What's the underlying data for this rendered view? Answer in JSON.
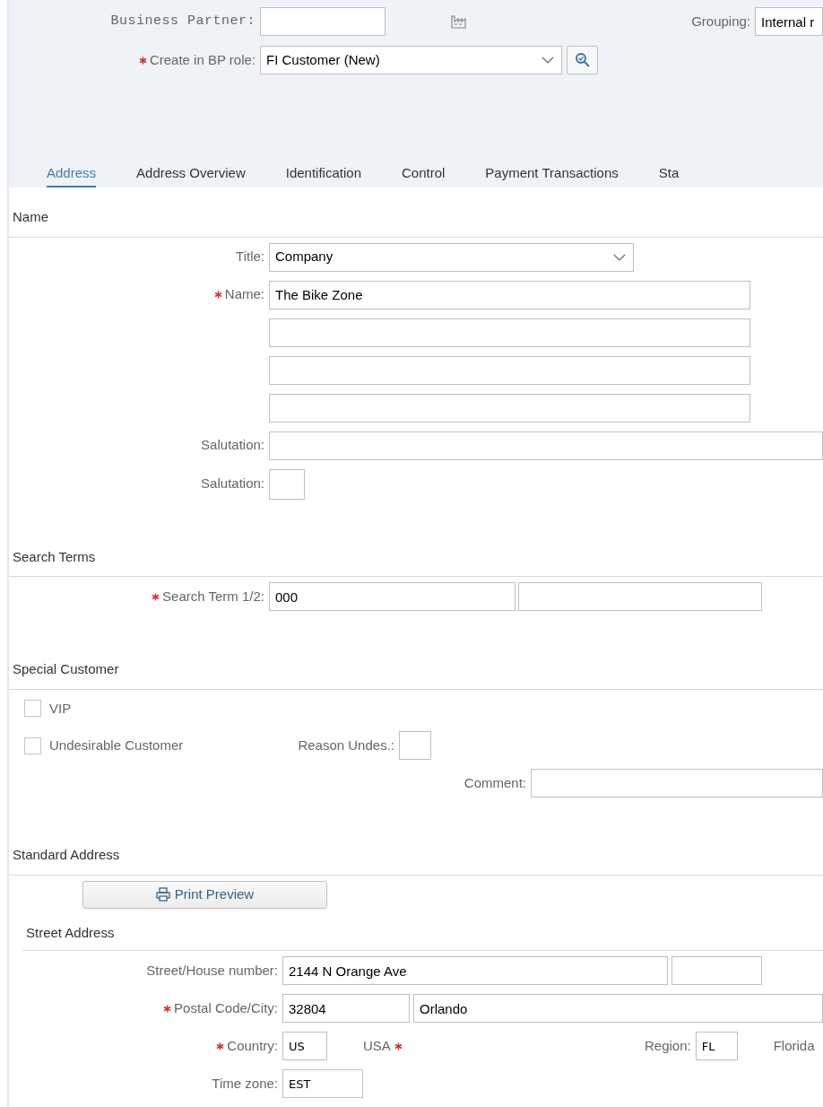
{
  "header": {
    "business_partner": {
      "label": "Business Partner:",
      "required": false
    },
    "grouping": {
      "label": "Grouping:",
      "value": "Internal r"
    },
    "bp_role": {
      "label": "Create in BP role:",
      "required": true,
      "value": "FI Customer (New)"
    }
  },
  "tabs": [
    {
      "label": "Address",
      "selected": true
    },
    {
      "label": "Address Overview",
      "selected": false
    },
    {
      "label": "Identification",
      "selected": false
    },
    {
      "label": "Control",
      "selected": false
    },
    {
      "label": "Payment Transactions",
      "selected": false
    },
    {
      "label": "Sta",
      "selected": false
    }
  ],
  "name_section": {
    "title": "Name",
    "rows": [
      {
        "label": "Title:",
        "required": false,
        "inputs": [
          {
            "kind": "select",
            "value": "Company"
          }
        ]
      },
      {
        "label": "Name:",
        "required": true,
        "inputs": [
          {
            "kind": "text",
            "value": "The Bike Zone"
          }
        ]
      },
      {
        "inputs": [
          {
            "kind": "text"
          }
        ]
      },
      {
        "inputs": [
          {
            "kind": "text"
          }
        ]
      },
      {
        "inputs": [
          {
            "kind": "text"
          }
        ]
      },
      {
        "label": "Salutation:",
        "required": false,
        "inputs": [
          {
            "kind": "text"
          }
        ]
      },
      {
        "label": "Salutation:",
        "required": false,
        "inputs": [
          {
            "kind": "text"
          }
        ]
      }
    ]
  },
  "search_terms": {
    "title": "Search Terms",
    "rows": [
      {
        "label": "Search Term 1/2:",
        "required": true,
        "inputs": [
          {
            "kind": "text",
            "value": "000"
          },
          {
            "kind": "text"
          }
        ]
      }
    ]
  },
  "special_customer": {
    "title": "Special Customer",
    "checkboxes": [
      {
        "label": "VIP",
        "checked": false
      },
      {
        "label": "Undesirable Customer",
        "checked": false
      }
    ],
    "reason": {
      "label": "Reason Undes.:"
    },
    "comment": {
      "label": "Comment:"
    }
  },
  "standard_address": {
    "title": "Standard Address",
    "print_preview": {
      "label": "Print Preview"
    },
    "street_address": {
      "title": "Street Address",
      "rows": [
        {
          "label": "Street/House number:",
          "required": false,
          "inputs": [
            {
              "kind": "text",
              "value": "2144 N Orange Ave"
            },
            {
              "kind": "text"
            }
          ]
        },
        {
          "label": "Postal Code/City:",
          "required": true,
          "inputs": [
            {
              "kind": "text",
              "value": "32804"
            },
            {
              "kind": "text",
              "value": "Orlando"
            }
          ]
        },
        {
          "label": "Country:",
          "required": true,
          "inputs": [
            {
              "kind": "code",
              "value": "US"
            }
          ],
          "description": {
            "text": "USA",
            "required": true
          },
          "extra": {
            "label": "Region:",
            "value": "FL",
            "description": "Florida"
          }
        },
        {
          "label": "Time zone:",
          "required": false,
          "inputs": [
            {
              "kind": "code",
              "value": "EST"
            }
          ]
        }
      ]
    }
  }
}
